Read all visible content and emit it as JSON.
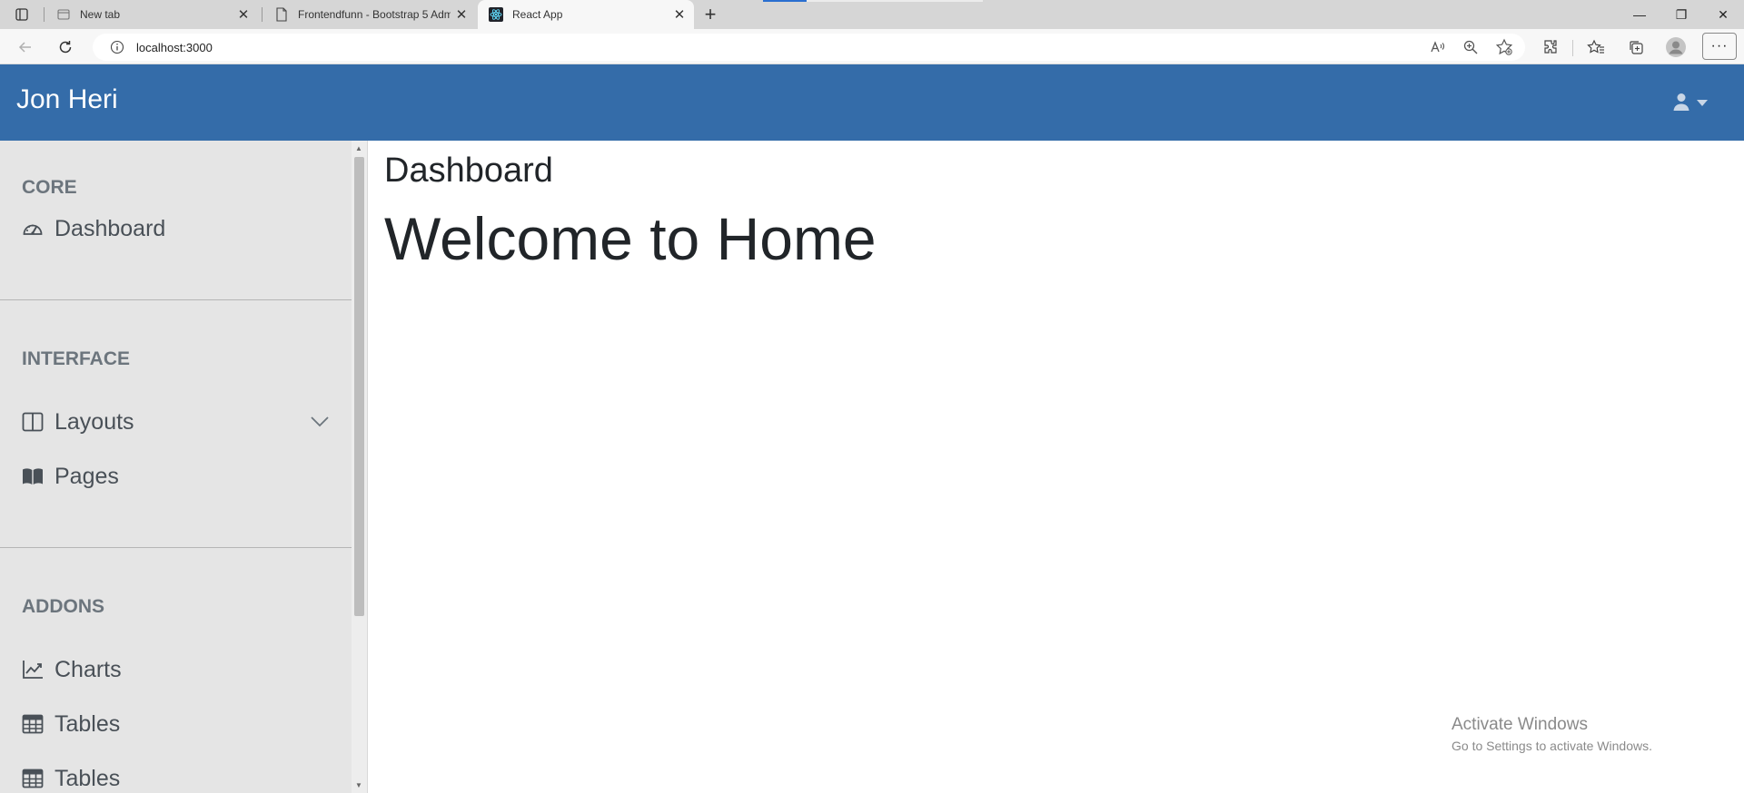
{
  "browser": {
    "tabs": [
      {
        "title": "New tab",
        "favicon": "new-tab-icon"
      },
      {
        "title": "Frontendfunn - Bootstrap 5 Adm",
        "favicon": "document-icon"
      },
      {
        "title": "React App",
        "favicon": "react-icon"
      }
    ],
    "active_tab": 2,
    "url": "localhost:3000",
    "icons": {
      "tab_actions": "tab-actions-icon",
      "close": "✕",
      "new_tab": "+",
      "minimize": "—",
      "restore": "❐",
      "window_close": "✕",
      "more": "···"
    }
  },
  "app": {
    "brand": "Jon Heri",
    "accent_color": "#346ca9",
    "user_menu_icon": "user-icon",
    "sidebar": {
      "sections": [
        {
          "heading": "CORE",
          "items": [
            {
              "label": "Dashboard",
              "icon": "speedometer-icon"
            }
          ]
        },
        {
          "heading": "INTERFACE",
          "items": [
            {
              "label": "Layouts",
              "icon": "columns-icon",
              "has_submenu": true
            },
            {
              "label": "Pages",
              "icon": "book-icon"
            }
          ]
        },
        {
          "heading": "ADDONS",
          "items": [
            {
              "label": "Charts",
              "icon": "chart-line-icon"
            },
            {
              "label": "Tables",
              "icon": "table-icon"
            },
            {
              "label": "Tables",
              "icon": "table-icon"
            }
          ]
        }
      ]
    },
    "main": {
      "page_title": "Dashboard",
      "welcome": "Welcome to Home"
    }
  },
  "os": {
    "watermark_line1": "Activate Windows",
    "watermark_line2": "Go to Settings to activate Windows."
  }
}
